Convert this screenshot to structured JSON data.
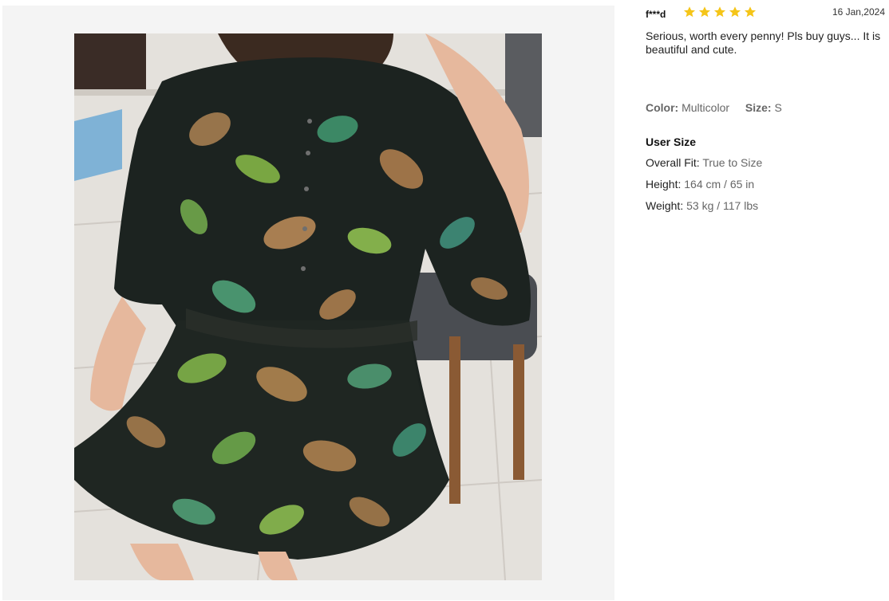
{
  "review": {
    "reviewer": "f***d",
    "rating": 5,
    "date": "16 Jan,2024",
    "comment": "Serious, worth every penny! Pls buy guys... It is beautiful and cute.",
    "attributes": {
      "color_label": "Color:",
      "color_value": "Multicolor",
      "size_label": "Size:",
      "size_value": "S"
    },
    "user_size": {
      "title": "User Size",
      "rows": [
        {
          "label": "Overall Fit:",
          "value": "True to Size"
        },
        {
          "label": "Height:",
          "value": "164 cm / 65 in"
        },
        {
          "label": "Weight:",
          "value": "53 kg / 117 lbs"
        }
      ]
    }
  },
  "colors": {
    "star": "#f5c518",
    "gallery_bg": "#f4f4f4"
  },
  "icons": {
    "star": "star-icon"
  }
}
